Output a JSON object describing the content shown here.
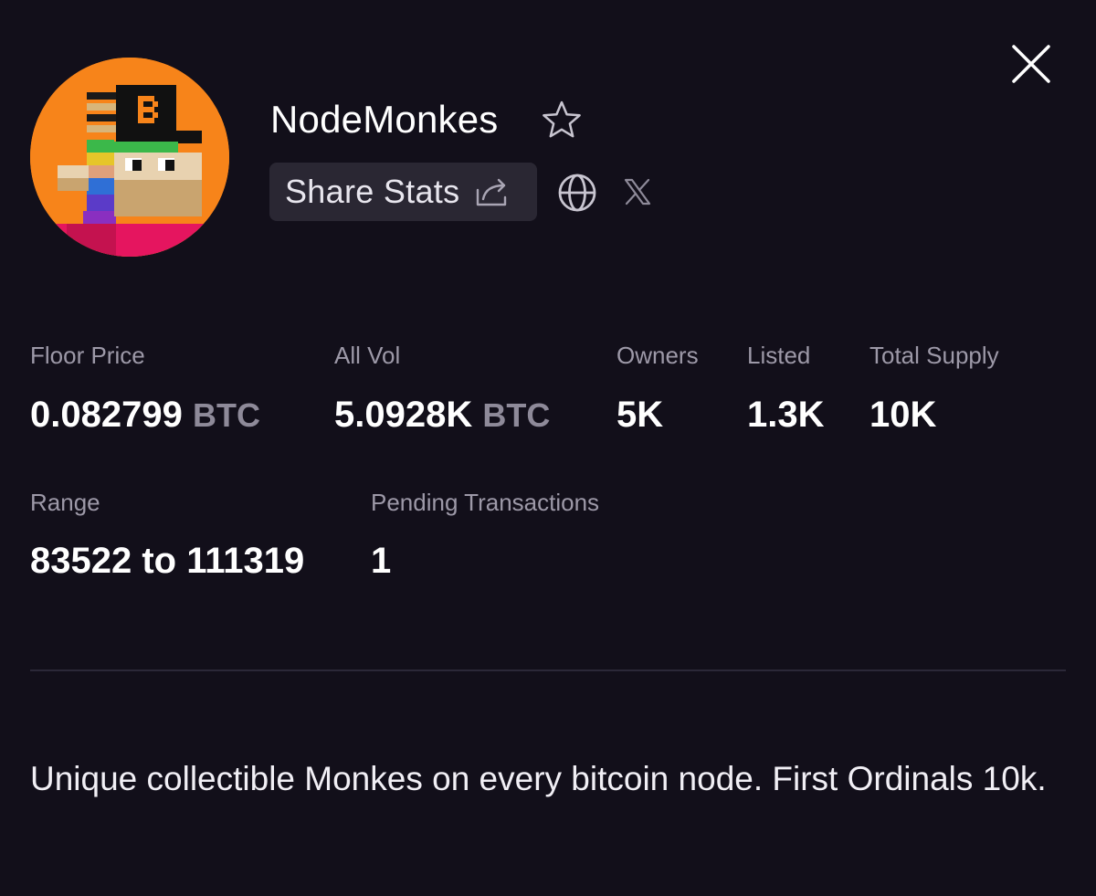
{
  "collection": {
    "name": "NodeMonkes",
    "avatar_icon": "nodemonkes-pixel-avatar"
  },
  "actions": {
    "share_label": "Share Stats",
    "share_icon": "share-arrow-icon",
    "favorite_icon": "star-outline-icon",
    "website_icon": "globe-icon",
    "social_icon": "x-logo-icon",
    "close_icon": "close-icon"
  },
  "stats": {
    "floor_price": {
      "label": "Floor Price",
      "value": "0.082799",
      "unit": "BTC"
    },
    "all_vol": {
      "label": "All Vol",
      "value": "5.0928K",
      "unit": "BTC"
    },
    "owners": {
      "label": "Owners",
      "value": "5K"
    },
    "listed": {
      "label": "Listed",
      "value": "1.3K"
    },
    "total_supply": {
      "label": "Total Supply",
      "value": "10K"
    },
    "range": {
      "label": "Range",
      "value": "83522 to 111319"
    },
    "pending": {
      "label": "Pending Transactions",
      "value": "1"
    }
  },
  "description": "Unique collectible Monkes on every bitcoin node. First Ordinals 10k.",
  "colors": {
    "background": "#120f1a",
    "avatar_orange": "#f7841a",
    "button_bg": "#2a2733",
    "muted_text": "#9d99a8"
  }
}
